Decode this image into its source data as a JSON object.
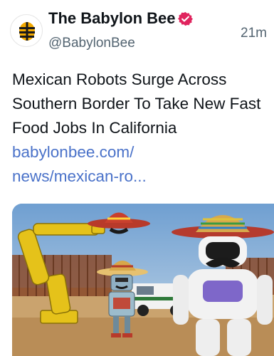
{
  "post": {
    "author_name": "The Babylon Bee",
    "handle": "@BabylonBee",
    "time": "21m",
    "text": "Mexican Robots Surge Across Southern Border To Take New Fast Food Jobs In California ",
    "link_text": "babylonbee.com/\nnews/mexican-ro..."
  },
  "icons": {
    "avatar": "bee-logo-icon",
    "verified": "verified-badge-icon"
  },
  "colors": {
    "link": "#4a72c9",
    "verified": "#e0245e",
    "bee_logo": "#f2a900"
  }
}
